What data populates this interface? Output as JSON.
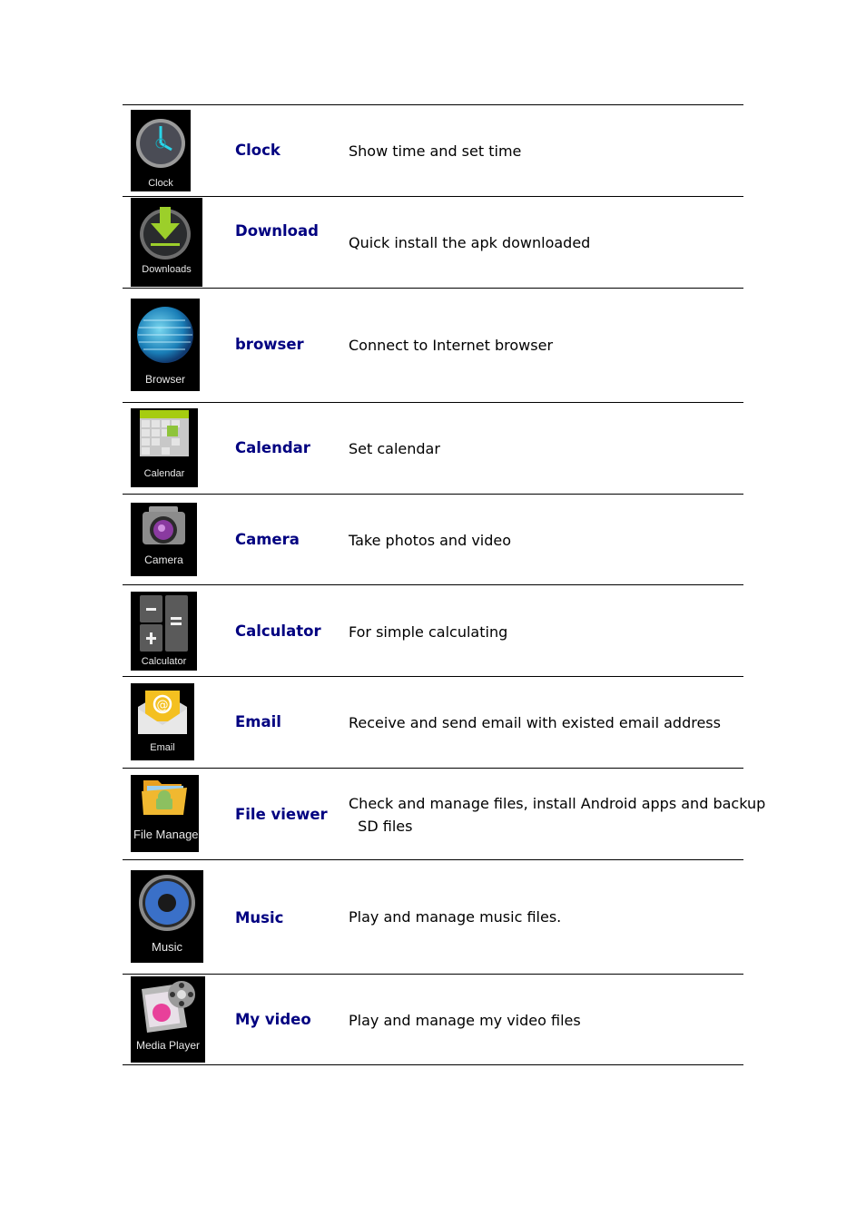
{
  "table": {
    "rows": [
      {
        "icon": "clock-icon",
        "icon_label": "Clock",
        "name": "Clock",
        "description": "Show time and set time"
      },
      {
        "icon": "download-icon",
        "icon_label": "Downloads",
        "name": "Download",
        "description": "Quick install the apk downloaded"
      },
      {
        "icon": "browser-globe-icon",
        "icon_label": "Browser",
        "name": "browser",
        "description": "Connect to Internet browser"
      },
      {
        "icon": "calendar-icon",
        "icon_label": "Calendar",
        "name": "Calendar",
        "description": "Set calendar"
      },
      {
        "icon": "camera-icon",
        "icon_label": "Camera",
        "name": "Camera",
        "description": "Take photos and video"
      },
      {
        "icon": "calculator-icon",
        "icon_label": "Calculator",
        "name": "Calculator",
        "description": "For simple calculating"
      },
      {
        "icon": "email-icon",
        "icon_label": "Email",
        "name": "Email",
        "description": "Receive and send email with existed email address"
      },
      {
        "icon": "file-manager-icon",
        "icon_label": "File Manage",
        "name": "File viewer",
        "description": "Check and manage files, install Android apps and backup\n  SD files"
      },
      {
        "icon": "music-speaker-icon",
        "icon_label": "Music",
        "name": "Music",
        "description": "Play and manage music files."
      },
      {
        "icon": "media-player-icon",
        "icon_label": "Media Player",
        "name": "My video",
        "description": "Play and manage my video files"
      }
    ]
  },
  "colors": {
    "name_text": "#000080",
    "icon_bg": "#000000"
  }
}
